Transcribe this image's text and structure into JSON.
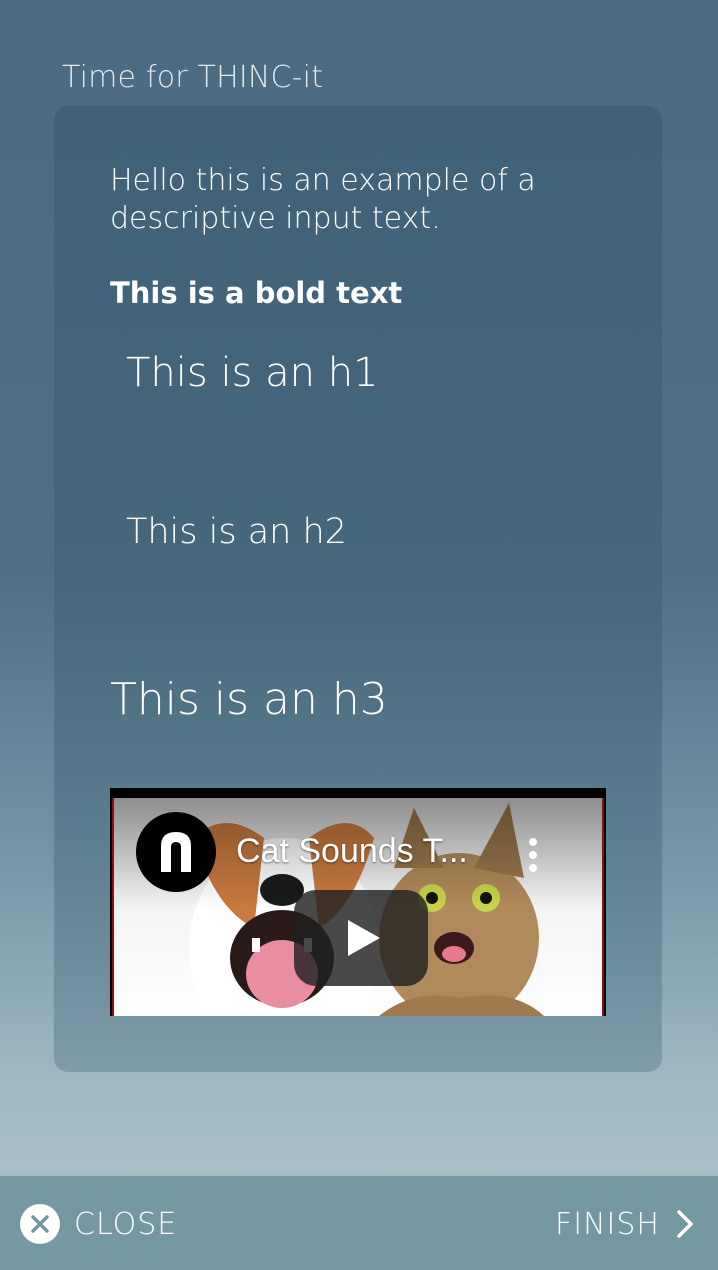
{
  "header": {
    "title": "Time for THINC-it"
  },
  "content": {
    "description": "Hello this is an example of a descriptive input text.",
    "bold_text": "This is a bold text",
    "h1": "This is an h1",
    "h2": "This is an h2",
    "h3": "This is an h3"
  },
  "video": {
    "title": "Cat Sounds T...",
    "channel_icon": "channel-logo-icon",
    "play_icon": "play-icon",
    "more_icon": "more-vertical-icon",
    "border_color": "#8a1010"
  },
  "footer": {
    "close_label": "CLOSE",
    "close_icon": "close-icon",
    "finish_label": "FINISH",
    "finish_icon": "chevron-right-icon",
    "background": "#7498a2"
  }
}
